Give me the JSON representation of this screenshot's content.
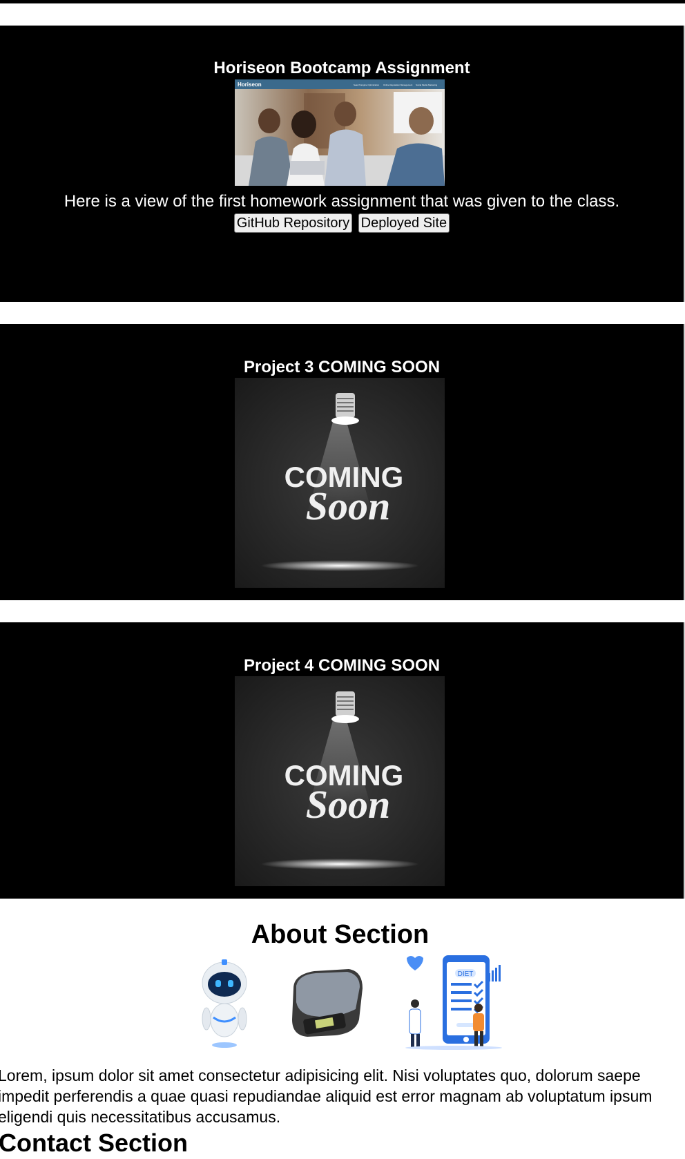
{
  "projects": [
    {
      "title": "Horiseon Bootcamp Assignment",
      "image_icon": "horiseon-screenshot",
      "image_brand": "Horiseon",
      "image_nav": [
        "Search Engine Optimization",
        "Online Reputation Management",
        "Social Media Marketing"
      ],
      "description": "Here is a view of the first homework assignment that was given to the class.",
      "buttons": [
        "GitHub Repository",
        "Deployed Site"
      ]
    },
    {
      "title": "Project 3 COMING SOON",
      "image_icon": "coming-soon-spotlight",
      "image_text_top": "COMING",
      "image_text_bottom": "Soon"
    },
    {
      "title": "Project 4 COMING SOON",
      "image_icon": "coming-soon-spotlight",
      "image_text_top": "COMING",
      "image_text_bottom": "Soon"
    }
  ],
  "about": {
    "title": "About Section",
    "images": [
      "robot-icon",
      "kitchen-scale-icon",
      "diet-app-illustration"
    ],
    "diet_label": "DIET",
    "text": "Lorem, ipsum dolor sit amet consectetur adipisicing elit. Nisi voluptates quo, dolorum saepe impedit perferendis a quae quasi repudiandae aliquid est error magnam ab voluptatum ipsum eligendi quis necessitatibus accusamus."
  },
  "contact": {
    "title": "Contact Section"
  },
  "colors": {
    "section_bg": "#000000",
    "page_bg": "#ffffff",
    "accent_blue": "#2a6fe0"
  }
}
